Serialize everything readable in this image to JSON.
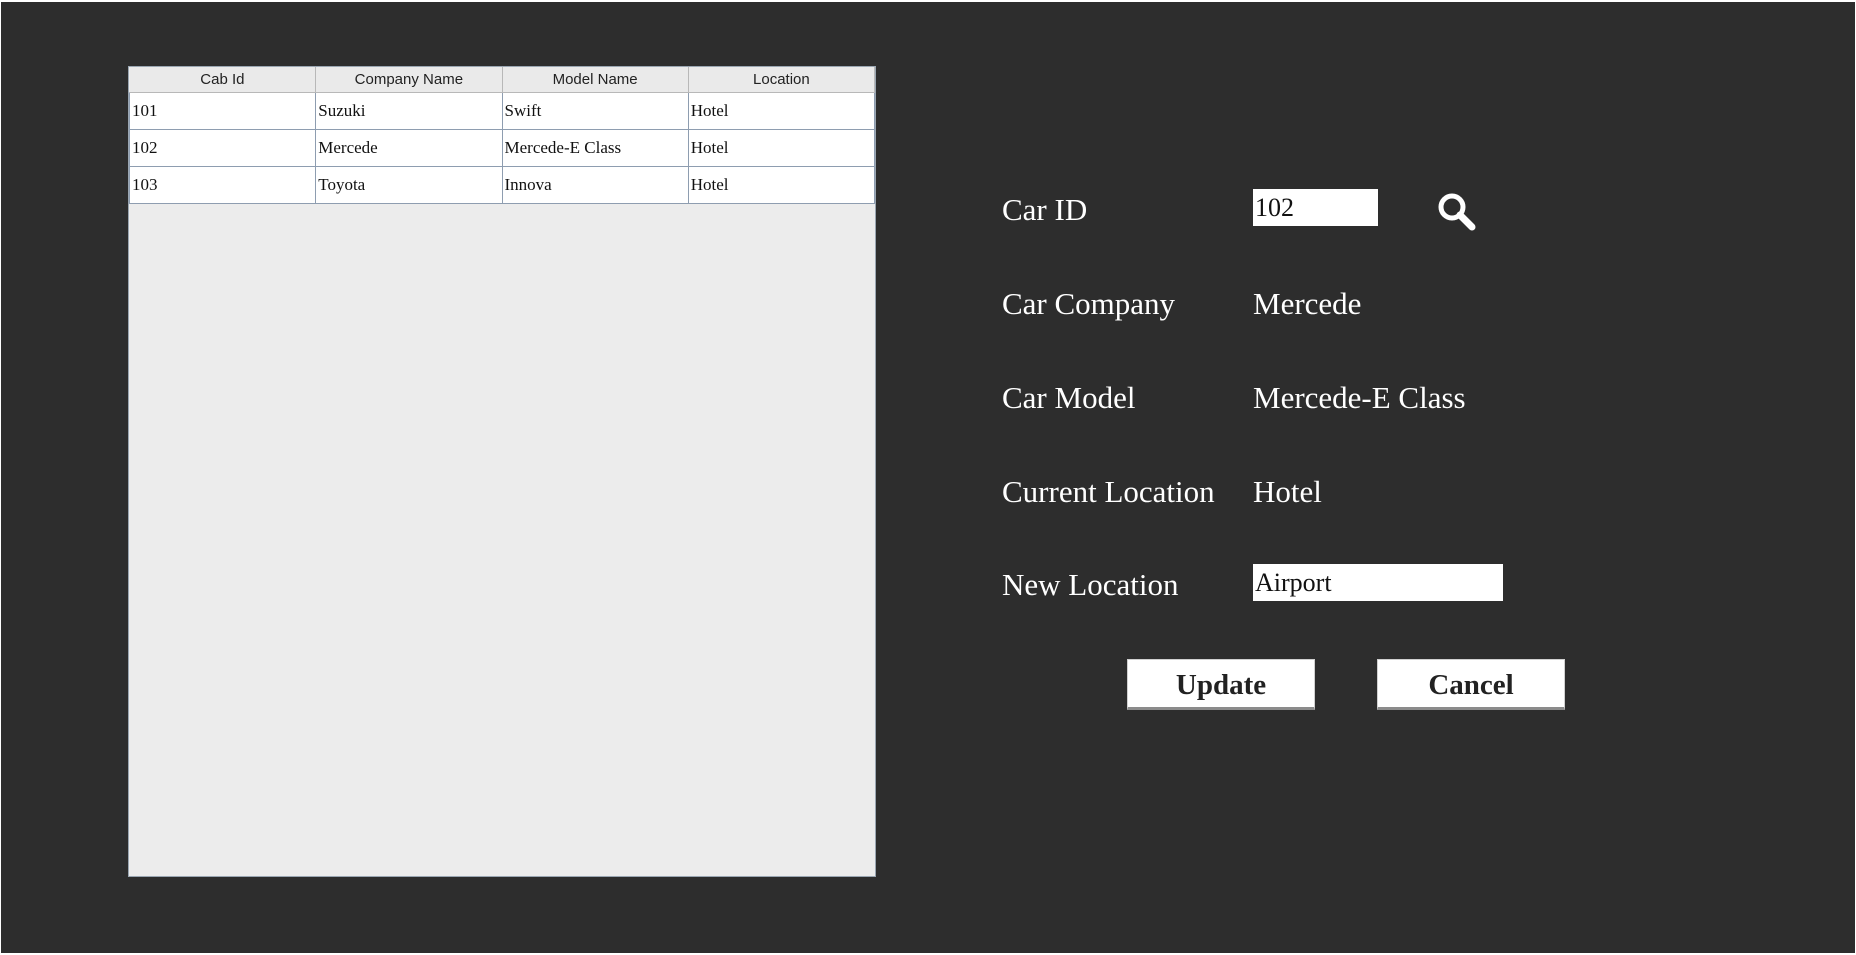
{
  "table": {
    "columns": [
      "Cab Id",
      "Company Name",
      "Model Name",
      "Location"
    ],
    "rows": [
      [
        "101",
        "Suzuki",
        "Swift",
        "Hotel"
      ],
      [
        "102",
        "Mercede",
        "Mercede-E Class",
        "Hotel"
      ],
      [
        "103",
        "Toyota",
        "Innova",
        "Hotel"
      ]
    ]
  },
  "form": {
    "car_id_label": "Car ID",
    "car_id_value": "102",
    "car_company_label": "Car Company",
    "car_company_value": "Mercede",
    "car_model_label": "Car Model",
    "car_model_value": "Mercede-E Class",
    "current_location_label": "Current Location",
    "current_location_value": "Hotel",
    "new_location_label": "New Location",
    "new_location_value": "Airport",
    "search_icon": "search-icon"
  },
  "buttons": {
    "update_label": "Update",
    "cancel_label": "Cancel"
  },
  "colors": {
    "background": "#2d2d2d",
    "table_background": "#ececec",
    "text_light": "#ffffff"
  }
}
